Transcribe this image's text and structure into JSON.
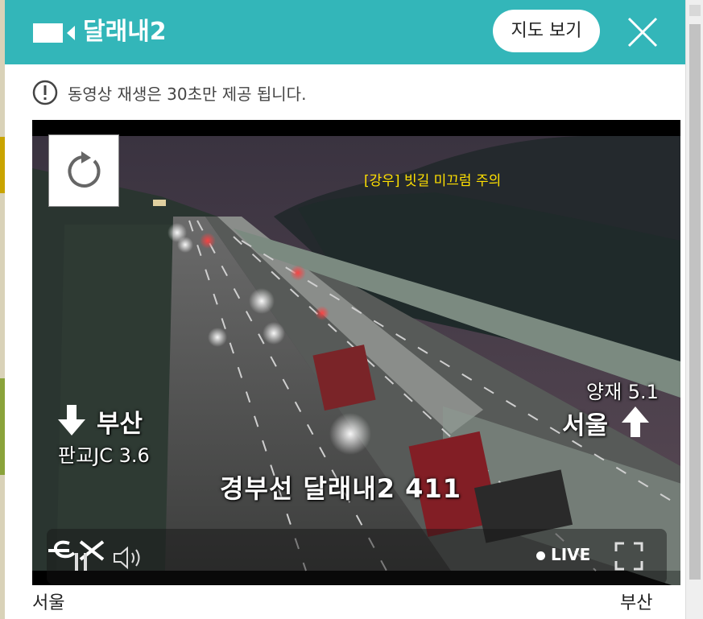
{
  "header": {
    "title": "달래내2",
    "map_button": "지도 보기",
    "camera_icon": "video-camera-icon",
    "close_icon": "close-icon"
  },
  "notice": {
    "icon": "exclamation-circle-icon",
    "text": "동영상 재생은 30초만 제공 됩니다."
  },
  "video": {
    "reload_icon": "reload-icon",
    "warning": "[강우] 빗길 미끄럼 주의",
    "direction_left": "부산",
    "distance_left": "판교JC 3.6",
    "distance_right": "양재 5.1",
    "direction_right": "서울",
    "camera_label": "경부선   달래내2   411",
    "controls": {
      "logo": "ex",
      "pause_icon": "pause-icon",
      "volume_icon": "volume-icon",
      "live": "LIVE",
      "fullscreen_icon": "fullscreen-icon"
    }
  },
  "footer": {
    "left": "서울",
    "right": "부산"
  },
  "colors": {
    "header_bg": "#33b6b9",
    "warning_text": "#ffe000"
  }
}
